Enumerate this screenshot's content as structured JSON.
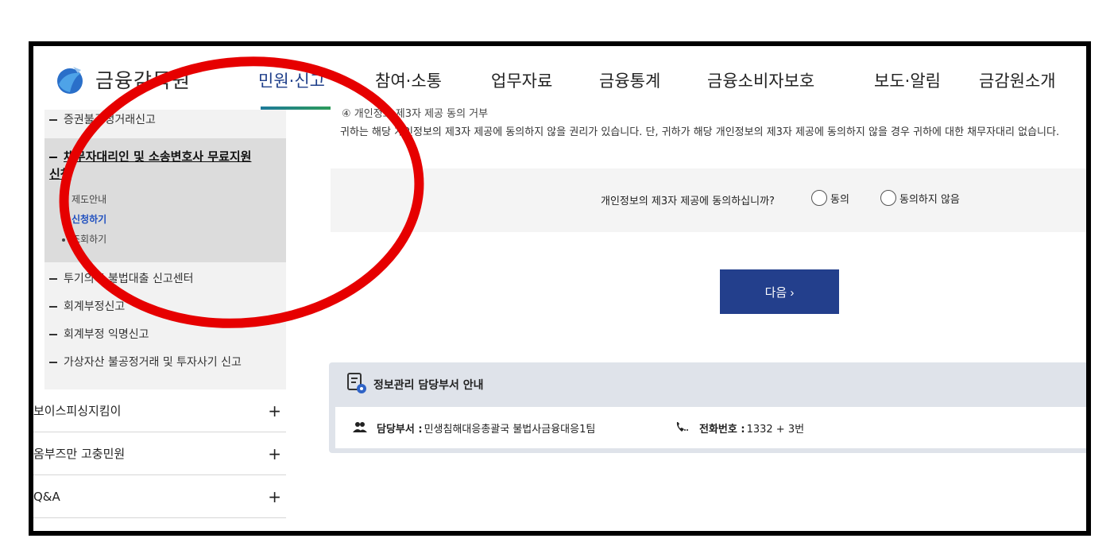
{
  "header": {
    "logo_text": "금융감독원",
    "nav": [
      "민원·신고",
      "참여·소통",
      "업무자료",
      "금융통계",
      "금융소비자보호",
      "보도·알림",
      "금감원소개"
    ],
    "active_nav": "민원·신고"
  },
  "sidebar": {
    "items_top": [
      "증권불공정거래신고"
    ],
    "active_item": "채무자대리인 및 소송변호사 무료지원 신청",
    "active_children": [
      "제도안내",
      "신청하기",
      "조회하기"
    ],
    "active_child": "신청하기",
    "items_bottom": [
      "투기의혹 불법대출 신고센터",
      "회계부정신고",
      "회계부정 익명신고",
      "가상자산 불공정거래 및 투자사기 신고"
    ],
    "accordion": [
      "보이스피싱지킴이",
      "옴부즈만 고충민원",
      "Q&A"
    ],
    "plus": "+"
  },
  "consent": {
    "heading": "④ 개인정보 제3자 제공 동의 거부",
    "text": "귀하는 해당 개인정보의 제3자 제공에 동의하지 않을 권리가 있습니다. 단, 귀하가 해당 개인정보의 제3자 제공에 동의하지 않을 경우 귀하에 대한 채무자대리 없습니다.",
    "question": "개인정보의 제3자 제공에 동의하십니까?",
    "agree": "동의",
    "disagree": "동의하지 않음"
  },
  "next_button": "다음 ›",
  "info": {
    "title": "정보관리 담당부서 안내",
    "dept_label": "담당부서 :",
    "dept_value": "민생침해대응총괄국 불법사금융대응1팀",
    "phone_label": "전화번호 :",
    "phone_value": "1332 + 3번"
  },
  "colors": {
    "primary": "#233f8c",
    "annotation": "#e60000",
    "active_link": "#1f4fbf"
  }
}
